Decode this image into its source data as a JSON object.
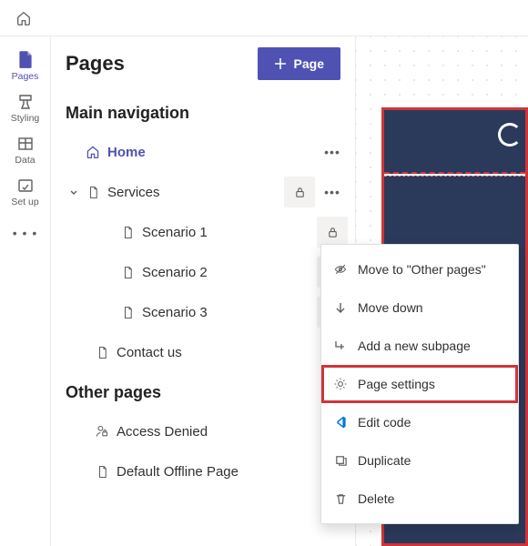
{
  "topbar": {},
  "rail": {
    "items": [
      {
        "id": "pages",
        "label": "Pages",
        "active": true
      },
      {
        "id": "styling",
        "label": "Styling"
      },
      {
        "id": "data",
        "label": "Data"
      },
      {
        "id": "setup",
        "label": "Set up"
      }
    ]
  },
  "panel": {
    "title": "Pages",
    "new_button_label": "Page",
    "sections": {
      "main_nav_title": "Main navigation",
      "other_pages_title": "Other pages"
    },
    "tree": {
      "home": "Home",
      "services": "Services",
      "scenario1": "Scenario 1",
      "scenario2": "Scenario 2",
      "scenario3": "Scenario 3",
      "contact": "Contact us",
      "access_denied": "Access Denied",
      "default_offline": "Default Offline Page"
    }
  },
  "context_menu": {
    "move_to_other": "Move to \"Other pages\"",
    "move_down": "Move down",
    "add_subpage": "Add a new subpage",
    "page_settings": "Page settings",
    "edit_code": "Edit code",
    "duplicate": "Duplicate",
    "delete": "Delete"
  }
}
